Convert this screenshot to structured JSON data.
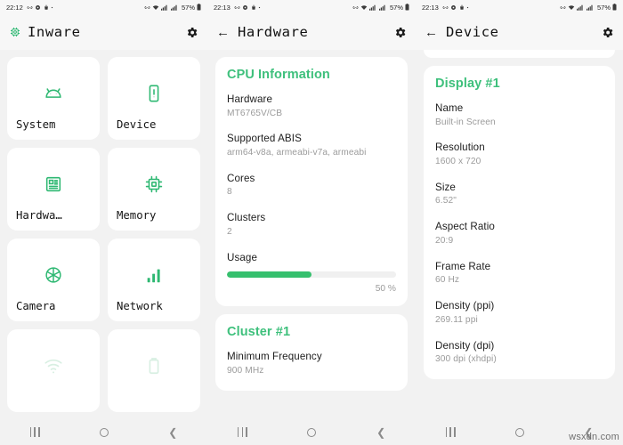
{
  "colors": {
    "accent_green": "#2eb872",
    "title_green": "#3ec07c",
    "progress_green": "#36c06e",
    "app_bg": "#f2f2f2",
    "card_bg": "#ffffff",
    "statusbar_bg": "#f7f7f7",
    "key_text": "#1d1d1d",
    "value_text": "#9b9b9b"
  },
  "watermark": "wsxdn.com",
  "screens": [
    {
      "id": "home",
      "statusbar": {
        "time": "22:12",
        "left_icons": [
          "link-icon",
          "gear-icon",
          "shopping-bag-icon",
          "dot-icon"
        ],
        "right_icons": [
          "link-icon",
          "wifi-icon",
          "signal-bars-icon",
          "signal-bars-icon"
        ],
        "battery": "57%",
        "battery_icon": "battery-icon"
      },
      "appbar": {
        "brand_icon": "chip-icon",
        "title": "Inware",
        "settings_icon": "gear-icon",
        "back_icon": null
      },
      "tiles": [
        {
          "label": "System",
          "icon": "android-head-icon"
        },
        {
          "label": "Device",
          "icon": "smartphone-icon"
        },
        {
          "label": "Hardwa…",
          "icon": "memory-chip-icon"
        },
        {
          "label": "Memory",
          "icon": "cpu-icon"
        },
        {
          "label": "Camera",
          "icon": "camera-aperture-icon"
        },
        {
          "label": "Network",
          "icon": "signal-bars-icon"
        },
        {
          "label": "",
          "icon": "wifi-icon"
        },
        {
          "label": "",
          "icon": "battery-icon"
        }
      ],
      "navbar": {
        "recents": "recents-icon",
        "home": "home-icon",
        "back": "back-icon"
      }
    },
    {
      "id": "hardware",
      "statusbar": {
        "time": "22:13",
        "left_icons": [
          "link-icon",
          "gear-icon",
          "shopping-bag-icon",
          "dot-icon"
        ],
        "right_icons": [
          "link-icon",
          "wifi-icon",
          "signal-bars-icon",
          "signal-bars-icon"
        ],
        "battery": "57%",
        "battery_icon": "battery-icon"
      },
      "appbar": {
        "brand_icon": null,
        "back_icon": "arrow-left-icon",
        "title": "Hardware",
        "settings_icon": "gear-icon"
      },
      "cards": [
        {
          "title": "CPU Information",
          "rows": [
            {
              "key": "Hardware",
              "value": "MT6765V/CB"
            },
            {
              "key": "Supported ABIS",
              "value": "arm64-v8a, armeabi-v7a, armeabi"
            },
            {
              "key": "Cores",
              "value": "8"
            },
            {
              "key": "Clusters",
              "value": "2"
            },
            {
              "key": "Usage",
              "value": null,
              "progress": 50,
              "progress_label": "50 %"
            }
          ]
        },
        {
          "title": "Cluster #1",
          "rows": [
            {
              "key": "Minimum Frequency",
              "value": "900 MHz"
            }
          ]
        }
      ],
      "navbar": {
        "recents": "recents-icon",
        "home": "home-icon",
        "back": "back-icon"
      }
    },
    {
      "id": "device",
      "statusbar": {
        "time": "22:13",
        "left_icons": [
          "link-icon",
          "gear-icon",
          "shopping-bag-icon",
          "dot-icon"
        ],
        "right_icons": [
          "link-icon",
          "wifi-icon",
          "signal-bars-icon",
          "signal-bars-icon"
        ],
        "battery": "57%",
        "battery_icon": "battery-icon"
      },
      "appbar": {
        "brand_icon": null,
        "back_icon": "arrow-left-icon",
        "title": "Device",
        "settings_icon": "gear-icon"
      },
      "cards": [
        {
          "title": "Display #1",
          "rows": [
            {
              "key": "Name",
              "value": "Built-in Screen"
            },
            {
              "key": "Resolution",
              "value": "1600 x 720"
            },
            {
              "key": "Size",
              "value": "6.52\""
            },
            {
              "key": "Aspect Ratio",
              "value": "20:9"
            },
            {
              "key": "Frame Rate",
              "value": "60 Hz"
            },
            {
              "key": "Density (ppi)",
              "value": "269.11 ppi"
            },
            {
              "key": "Density (dpi)",
              "value": "300 dpi (xhdpi)"
            }
          ]
        }
      ],
      "navbar": {
        "recents": "recents-icon",
        "home": "home-icon",
        "back": "back-icon"
      }
    }
  ]
}
